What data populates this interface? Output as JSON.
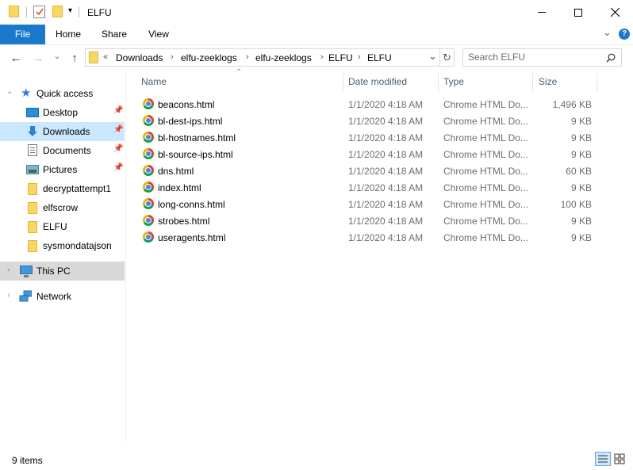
{
  "window": {
    "title": "ELFU",
    "minimize_glyph": "—",
    "maximize_glyph": "☐",
    "close_glyph": "✕"
  },
  "ribbon": {
    "tabs": [
      "File",
      "Home",
      "Share",
      "View"
    ],
    "expand_glyph": "⌄",
    "help_glyph": "?"
  },
  "address": {
    "overflow": "«",
    "crumbs": [
      "Downloads",
      "elfu-zeeklogs",
      "elfu-zeeklogs",
      "ELFU",
      "ELFU"
    ],
    "sep": "›",
    "dropdown_glyph": "⌄",
    "refresh_glyph": "↻"
  },
  "nav": {
    "back_glyph": "←",
    "forward_glyph": "→",
    "recent_glyph": "⌄",
    "up_glyph": "↑"
  },
  "search": {
    "placeholder": "Search ELFU",
    "icon": "search-icon"
  },
  "sidebar": {
    "quick_access": "Quick access",
    "items": [
      {
        "label": "Desktop",
        "icon": "desktop-icon",
        "pinned": true
      },
      {
        "label": "Downloads",
        "icon": "download-icon",
        "pinned": true
      },
      {
        "label": "Documents",
        "icon": "documents-icon",
        "pinned": true
      },
      {
        "label": "Pictures",
        "icon": "pictures-icon",
        "pinned": true
      },
      {
        "label": "decryptattempt1",
        "icon": "folder-icon",
        "pinned": false
      },
      {
        "label": "elfscrow",
        "icon": "folder-icon",
        "pinned": false
      },
      {
        "label": "ELFU",
        "icon": "folder-icon",
        "pinned": false
      },
      {
        "label": "sysmondatajson",
        "icon": "folder-icon",
        "pinned": false
      }
    ],
    "this_pc": "This PC",
    "network": "Network"
  },
  "columns": {
    "name": "Name",
    "date": "Date modified",
    "type": "Type",
    "size": "Size"
  },
  "files": [
    {
      "name": "beacons.html",
      "date": "1/1/2020 4:18 AM",
      "type": "Chrome HTML Do...",
      "size": "1,496 KB"
    },
    {
      "name": "bl-dest-ips.html",
      "date": "1/1/2020 4:18 AM",
      "type": "Chrome HTML Do...",
      "size": "9 KB"
    },
    {
      "name": "bl-hostnames.html",
      "date": "1/1/2020 4:18 AM",
      "type": "Chrome HTML Do...",
      "size": "9 KB"
    },
    {
      "name": "bl-source-ips.html",
      "date": "1/1/2020 4:18 AM",
      "type": "Chrome HTML Do...",
      "size": "9 KB"
    },
    {
      "name": "dns.html",
      "date": "1/1/2020 4:18 AM",
      "type": "Chrome HTML Do...",
      "size": "60 KB"
    },
    {
      "name": "index.html",
      "date": "1/1/2020 4:18 AM",
      "type": "Chrome HTML Do...",
      "size": "9 KB"
    },
    {
      "name": "long-conns.html",
      "date": "1/1/2020 4:18 AM",
      "type": "Chrome HTML Do...",
      "size": "100 KB"
    },
    {
      "name": "strobes.html",
      "date": "1/1/2020 4:18 AM",
      "type": "Chrome HTML Do...",
      "size": "9 KB"
    },
    {
      "name": "useragents.html",
      "date": "1/1/2020 4:18 AM",
      "type": "Chrome HTML Do...",
      "size": "9 KB"
    }
  ],
  "status": {
    "count": "9 items"
  },
  "colors": {
    "accent": "#1979ca",
    "selected_bg": "#cce8ff",
    "this_pc_bg": "#d9d9d9",
    "header_text": "#4c607a"
  }
}
